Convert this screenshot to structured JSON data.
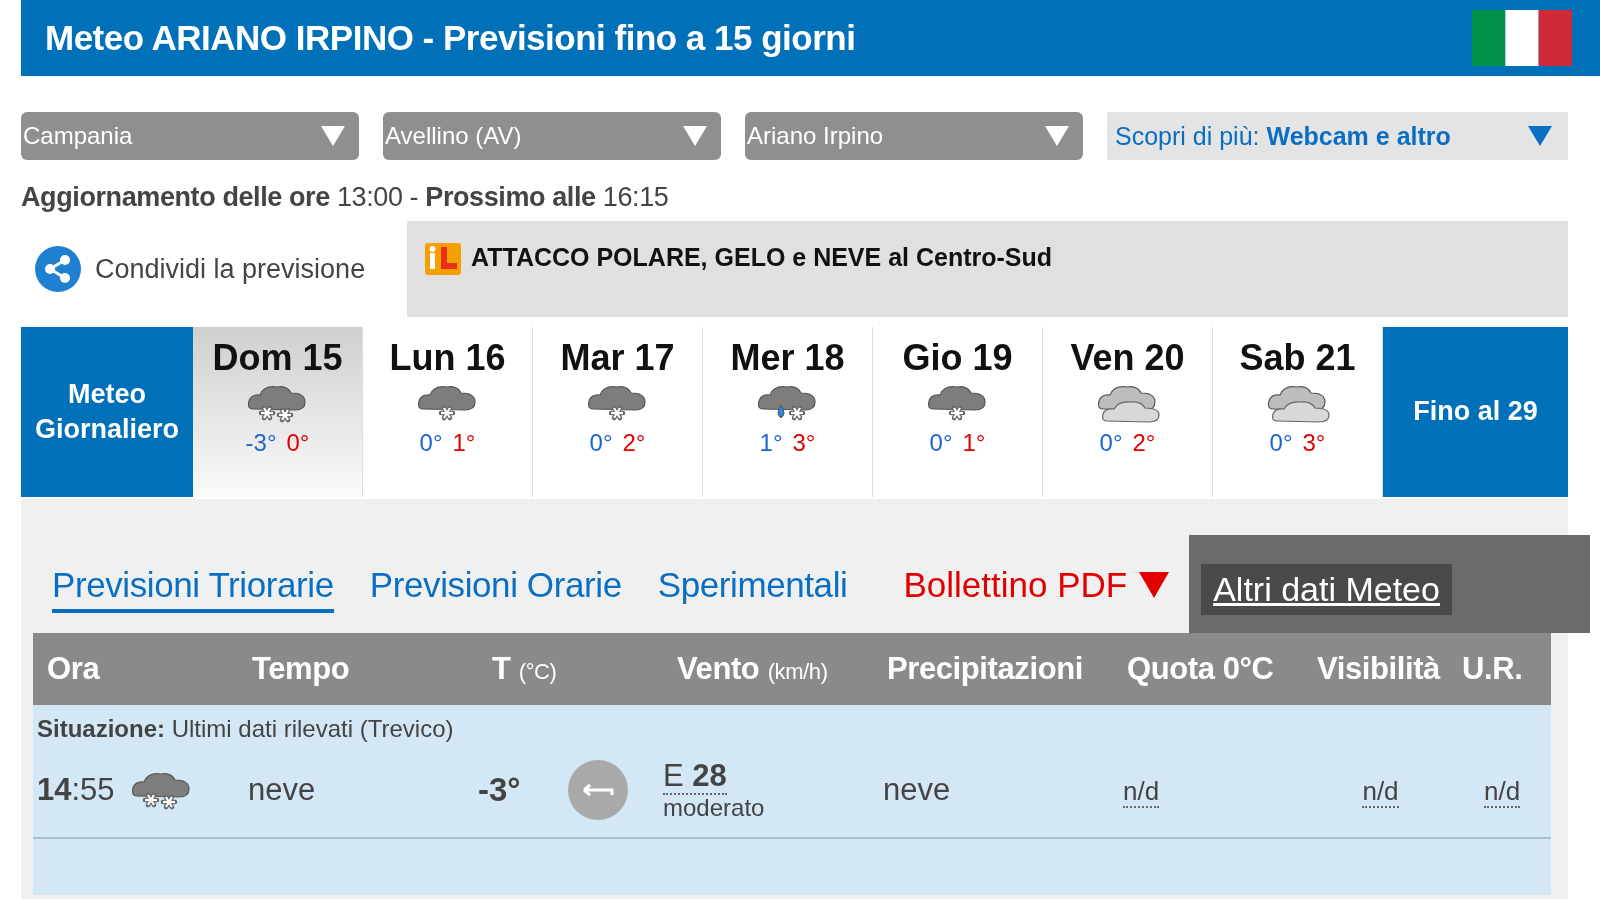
{
  "header": {
    "title": "Meteo ARIANO IRPINO - Previsioni fino a 15 giorni"
  },
  "selectors": [
    {
      "value": "Campania"
    },
    {
      "value": "Avellino (AV)"
    },
    {
      "value": "Ariano Irpino"
    }
  ],
  "discover": {
    "label": "Scopri di più:",
    "value": "Webcam e altro"
  },
  "update": "**Aggiornamento delle ore** 13:00 - **Prossimo alle** 16:15",
  "share": {
    "label": "Condividi la previsione"
  },
  "banner": {
    "text": "ATTACCO POLARE, GELO e NEVE al Centro-Sud"
  },
  "days": {
    "title": "Meteo Giornaliero",
    "more": "Fino al 29",
    "items": [
      {
        "label": "Dom 15",
        "kind": "heavy-snow",
        "min": "-3°",
        "max": "0°",
        "selected": true
      },
      {
        "label": "Lun 16",
        "kind": "snow",
        "min": "0°",
        "max": "1°",
        "selected": false
      },
      {
        "label": "Mar 17",
        "kind": "snow",
        "min": "0°",
        "max": "2°",
        "selected": false
      },
      {
        "label": "Mer 18",
        "kind": "sleet",
        "min": "1°",
        "max": "3°",
        "selected": false
      },
      {
        "label": "Gio 19",
        "kind": "snow",
        "min": "0°",
        "max": "1°",
        "selected": false
      },
      {
        "label": "Ven 20",
        "kind": "cloudy",
        "min": "0°",
        "max": "2°",
        "selected": false
      },
      {
        "label": "Sab 21",
        "kind": "cloudy",
        "min": "0°",
        "max": "3°",
        "selected": false
      }
    ]
  },
  "tabs": [
    {
      "label": "Previsioni Triorarie",
      "kind": "tab",
      "selected": true
    },
    {
      "label": "Previsioni Orarie",
      "kind": "tab",
      "selected": false
    },
    {
      "label": "Sperimentali",
      "kind": "tab",
      "selected": false
    },
    {
      "label": "Bollettino PDF",
      "kind": "pdf",
      "selected": false
    },
    {
      "label": "Altri dati Meteo",
      "kind": "dark",
      "selected": false
    }
  ],
  "table": {
    "columns": [
      {
        "label": "Ora"
      },
      {
        "label": "Tempo"
      },
      {
        "label": "T",
        "unit": "(°C)"
      },
      {
        "label": "Vento",
        "unit": "(km/h)"
      },
      {
        "label": "Precipitazioni"
      },
      {
        "label": "Quota 0°C"
      },
      {
        "label": "Visibilità"
      },
      {
        "label": "U.R."
      }
    ],
    "situation": "**Situazione:** Ultimi dati rilevati (Trevico)",
    "rows": [
      {
        "time": "**14**:55",
        "kind": "heavy-snow",
        "weather": "neve",
        "temp": "-3°",
        "wind_dir": "E",
        "wind_speed": "28",
        "wind_desc": "moderato",
        "precip": "neve",
        "quota": "n/d",
        "visibility": "n/d",
        "humidity": "n/d"
      }
    ]
  }
}
